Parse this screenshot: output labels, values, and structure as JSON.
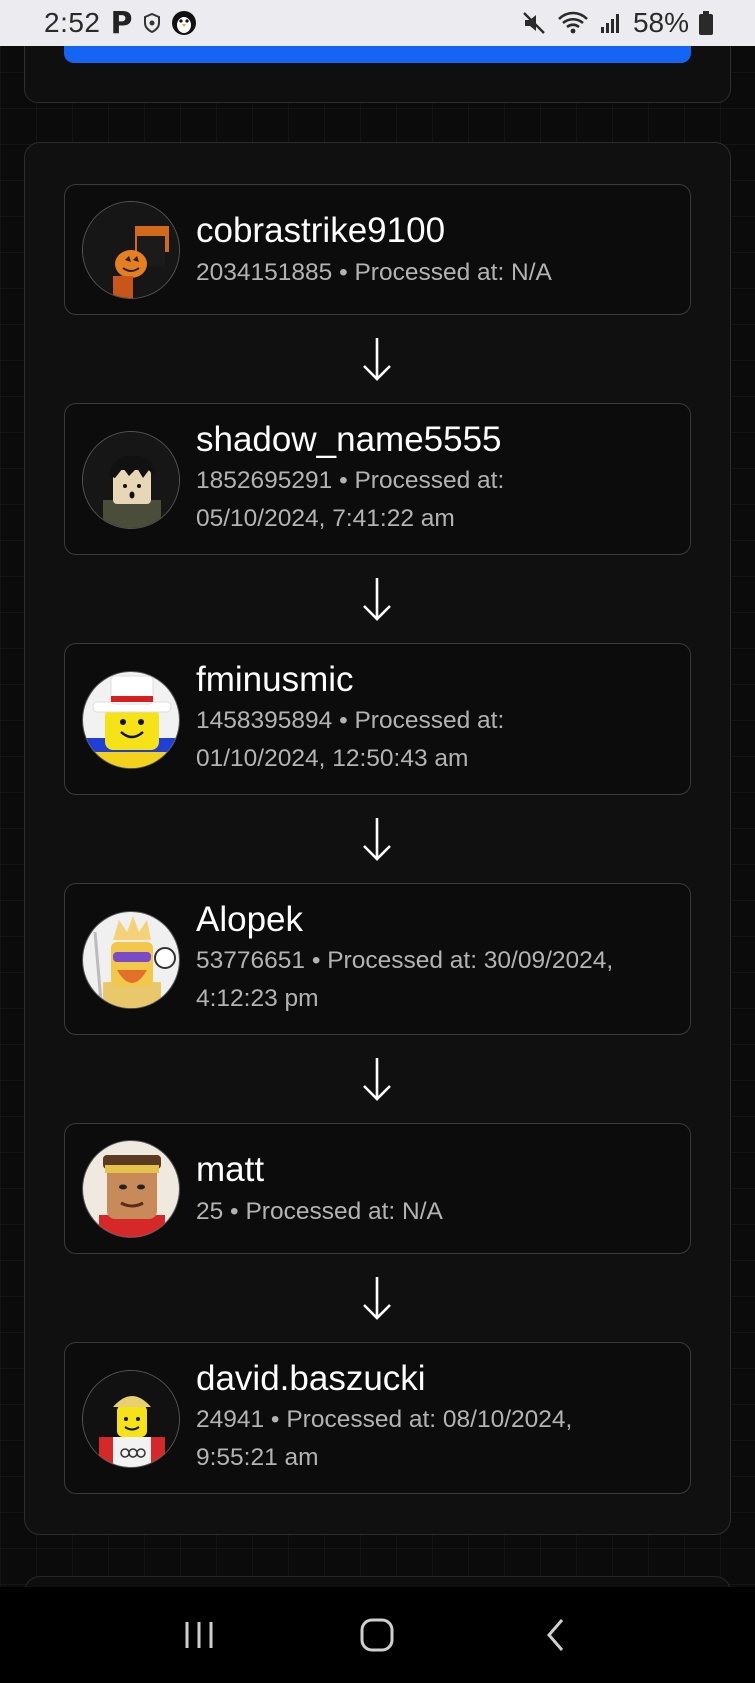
{
  "status_bar": {
    "time": "2:52",
    "app_icon_letter": "P",
    "battery": "58%",
    "icons": [
      "shield-icon",
      "penguin-icon",
      "mute-icon",
      "wifi-icon",
      "signal-icon",
      "battery-icon"
    ]
  },
  "chain": [
    {
      "name": "cobrastrike9100",
      "meta": "2034151885 • Processed at: N/A",
      "avatar": "pumpkin-avatar"
    },
    {
      "name": "shadow_name5555",
      "meta": "1852695291 • Processed at: 05/10/2024, 7:41:22 am",
      "avatar": "dark-hair-avatar"
    },
    {
      "name": "fminusmic",
      "meta": "1458395894 • Processed at: 01/10/2024, 12:50:43 am",
      "avatar": "smiley-hat-avatar"
    },
    {
      "name": "Alopek",
      "meta": "53776651 • Processed at: 30/09/2024, 4:12:23 pm",
      "avatar": "crowned-avatar"
    },
    {
      "name": "matt",
      "meta": "25 • Processed at: N/A",
      "avatar": "headband-avatar"
    },
    {
      "name": "david.baszucki",
      "meta": "24941 • Processed at: 08/10/2024, 9:55:21 am",
      "avatar": "hardhat-avatar"
    }
  ],
  "colors": {
    "accent_blue": "#1565f5",
    "background": "#0b0b0b",
    "card_border": "#3a3a3a",
    "meta_text": "#b3b3b3"
  },
  "nav": [
    "recent-apps-icon",
    "home-icon",
    "back-icon"
  ]
}
